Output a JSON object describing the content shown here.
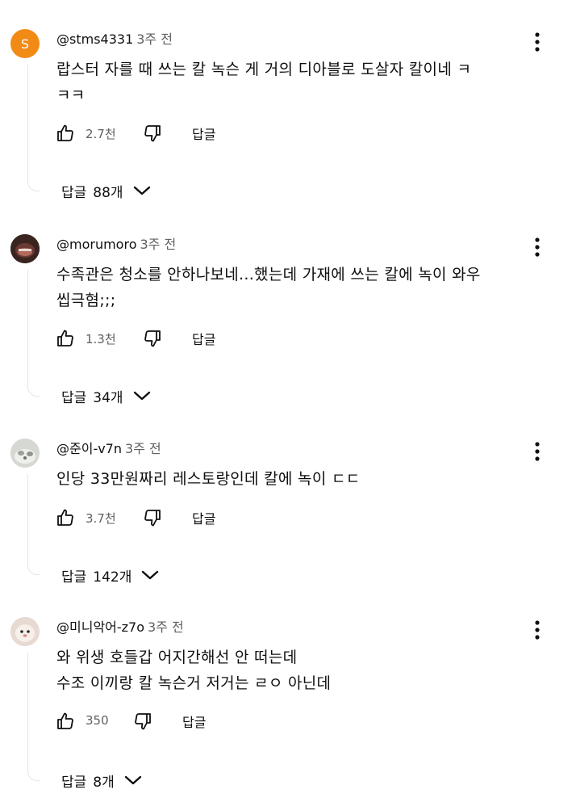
{
  "comments": [
    {
      "author": "@stms4331",
      "time": "3주 전",
      "avatar_letter": "S",
      "text": "랍스터 자를 때 쓰는 칼 녹슨 게 거의 디아블로 도살자 칼이네 ㅋ\nㅋㅋ",
      "likes": "2.7천",
      "reply_label": "답글",
      "replies_label": "답글",
      "replies_count": "88개"
    },
    {
      "author": "@morumoro",
      "time": "3주 전",
      "text": "수족관은 청소를 안하나보네...했는데 가재에 쓰는 칼에 녹이 와우\n씹극혐;;;",
      "likes": "1.3천",
      "reply_label": "답글",
      "replies_label": "답글",
      "replies_count": "34개"
    },
    {
      "author": "@준이-v7n",
      "time": "3주 전",
      "text": "인당 33만원짜리 레스토랑인데 칼에 녹이 ㄷㄷ",
      "likes": "3.7천",
      "reply_label": "답글",
      "replies_label": "답글",
      "replies_count": "142개"
    },
    {
      "author": "@미니악어-z7o",
      "time": "3주 전",
      "text": "와 위생 호들갑 어지간해선 안 떠는데\n수조 이끼랑 칼 녹슨거 저거는 ㄹㅇ 아닌데",
      "likes": "350",
      "reply_label": "답글",
      "replies_label": "답글",
      "replies_count": "8개"
    }
  ],
  "colors": {
    "text": "#0f0f0f",
    "secondary": "#606060",
    "avatar_orange": "#f28a16",
    "thread_line": "#e5e5e5"
  },
  "icons": [
    "like-icon",
    "dislike-icon",
    "more-vert-icon",
    "chevron-down-icon"
  ]
}
